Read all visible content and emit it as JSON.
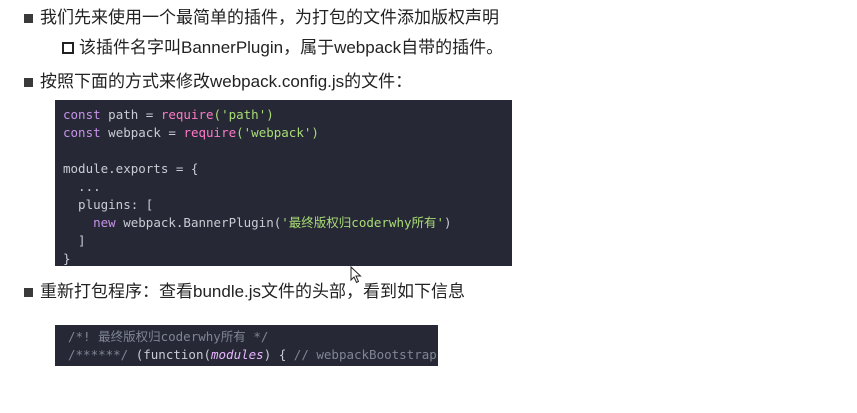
{
  "bullets": [
    {
      "text": "我们先来使用一个最简单的插件，为打包的文件添加版权声明"
    },
    {
      "text": "按照下面的方式来修改webpack.config.js的文件："
    },
    {
      "text": "重新打包程序：查看bundle.js文件的头部，看到如下信息"
    }
  ],
  "sub_bullet": {
    "text": "该插件名字叫BannerPlugin，属于webpack自带的插件。"
  },
  "code1": {
    "l1_kw": "const",
    "l1_var": " path = ",
    "l1_fn": "require",
    "l1_str": "('path')",
    "l2_kw": "const",
    "l2_var": " webpack = ",
    "l2_fn": "require",
    "l2_str": "('webpack')",
    "l4": "module.exports = {",
    "l5": "  ...",
    "l6": "  plugins: [",
    "l7_kw": "    new",
    "l7_var": " webpack.BannerPlugin(",
    "l7_str": "'最终版权归coderwhy所有'",
    "l7_end": ")",
    "l8": "  ]",
    "l9": "}"
  },
  "code2": {
    "l1": "/*! 最终版权归coderwhy所有 */",
    "l2_cm": "/******/ ",
    "l2_a": "(function(",
    "l2_b": "modules",
    "l2_c": ") { ",
    "l2_d": "// webpackBootstrap"
  }
}
